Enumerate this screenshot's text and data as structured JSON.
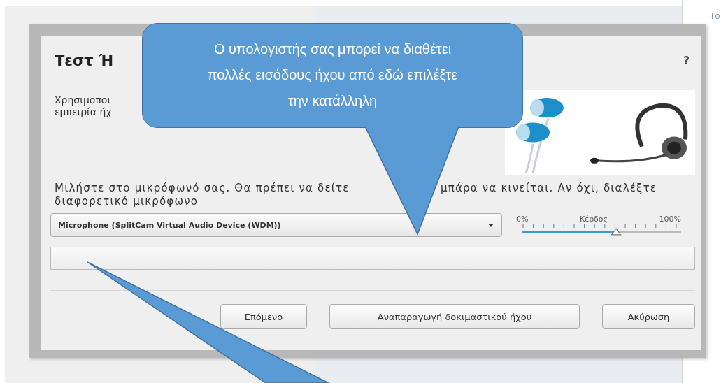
{
  "page": {
    "side_text": "Το"
  },
  "dialog": {
    "title": "Τεστ Ή",
    "help": "?",
    "description": [
      "Χρησιμοποι",
      "εμπειρία ήχ"
    ],
    "instruction": {
      "line_1": [
        "Μιλήστε στο μικρόφωνό σας. Θα πρέπει να δείτε",
        "μπάρα να κινείται. Αν όχι, διαλέξτε"
      ],
      "line_2": "διαφορετικό μικρόφωνο"
    },
    "device_select": {
      "value": "Microphone (SplitCam Virtual Audio Device (WDM))"
    },
    "gain": {
      "min_label": "0%",
      "label": "Κέρδος",
      "max_label": "100%",
      "level": 0.59
    },
    "buttons": [
      "Επόμενο",
      "Αναπαραγωγή δοκιμαστικού ήχου",
      "Ακύρωση"
    ]
  },
  "callout": {
    "lines": [
      "Ο υπολογιστής σας μπορεί να διαθέτει",
      "πολλές εισόδους ήχου από εδώ επιλέξτε",
      "την κατάλληλη"
    ]
  }
}
